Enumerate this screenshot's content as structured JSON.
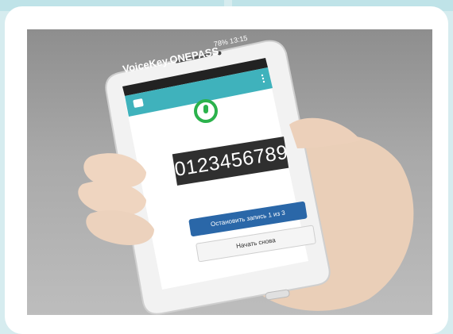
{
  "app": {
    "title": "VoiceKey.ONEPASS",
    "status_text": "78% 13:15"
  },
  "screen": {
    "digits": "0123456789",
    "stop_button_label": "Остановить запись 1 из 3",
    "restart_button_label": "Начать снова"
  },
  "colors": {
    "page_background": "#d6ecef",
    "card": "#ffffff",
    "app_header": "#3fb2bc",
    "mic_ring": "#2bb24c",
    "stop_button": "#2a67a8",
    "digits_background": "#2f2f2f"
  },
  "icons": {
    "app_icon": "voicekey-logo-icon",
    "mic": "microphone-icon",
    "menu": "overflow-menu-icon"
  }
}
